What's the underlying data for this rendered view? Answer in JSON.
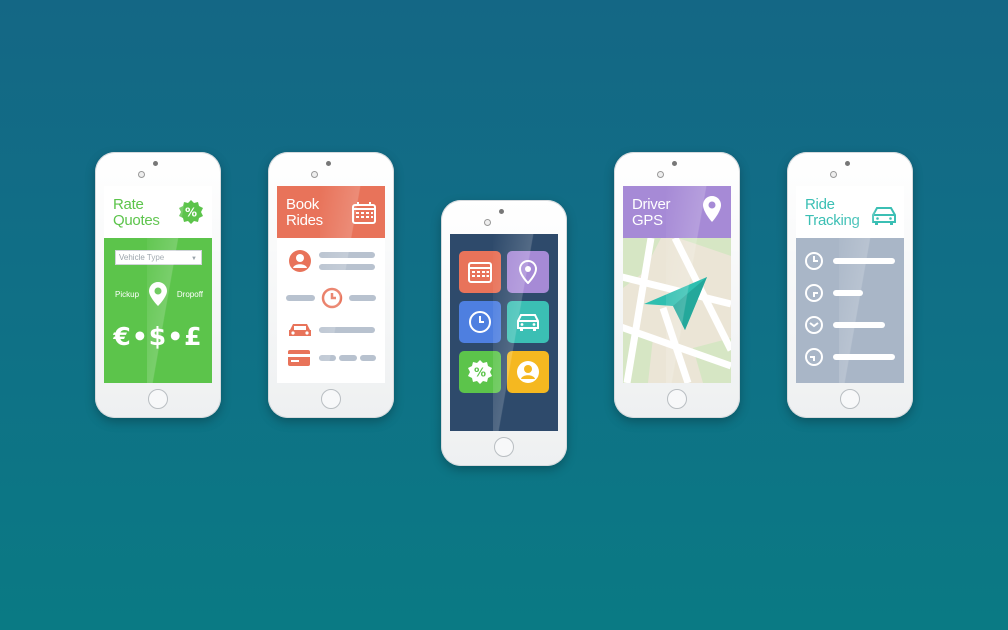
{
  "phones": {
    "rate_quotes": {
      "title": "Rate\nQuotes",
      "vehicle_placeholder": "Vehicle Type",
      "pickup_label": "Pickup",
      "dropoff_label": "Dropoff",
      "currency_symbols": "€•$•£",
      "icons": [
        "percent-badge-icon",
        "location-pin-icon"
      ],
      "accent": "#5cc44b"
    },
    "book_rides": {
      "title": "Book\nRides",
      "icons": [
        "calendar-icon",
        "user-icon",
        "clock-icon",
        "car-icon",
        "credit-card-icon"
      ],
      "accent": "#e8735a"
    },
    "home": {
      "tiles": [
        {
          "icon": "calendar-icon",
          "color": "#e8735a"
        },
        {
          "icon": "location-pin-icon",
          "color": "#a68ad6"
        },
        {
          "icon": "clock-icon",
          "color": "#4e7fe0"
        },
        {
          "icon": "car-icon",
          "color": "#3bbfb4"
        },
        {
          "icon": "percent-badge-icon",
          "color": "#5cc44b"
        },
        {
          "icon": "user-icon",
          "color": "#f5b820"
        }
      ]
    },
    "driver_gps": {
      "title": "Driver\nGPS",
      "icons": [
        "location-pin-icon",
        "navigation-arrow-icon"
      ],
      "accent": "#a68ad6"
    },
    "ride_tracking": {
      "title": "Ride\nTracking",
      "icons": [
        "car-icon",
        "clock-icon"
      ],
      "accent": "#3bbfb4"
    }
  },
  "background": {
    "top": "#146785",
    "bottom": "#0a7a84"
  }
}
